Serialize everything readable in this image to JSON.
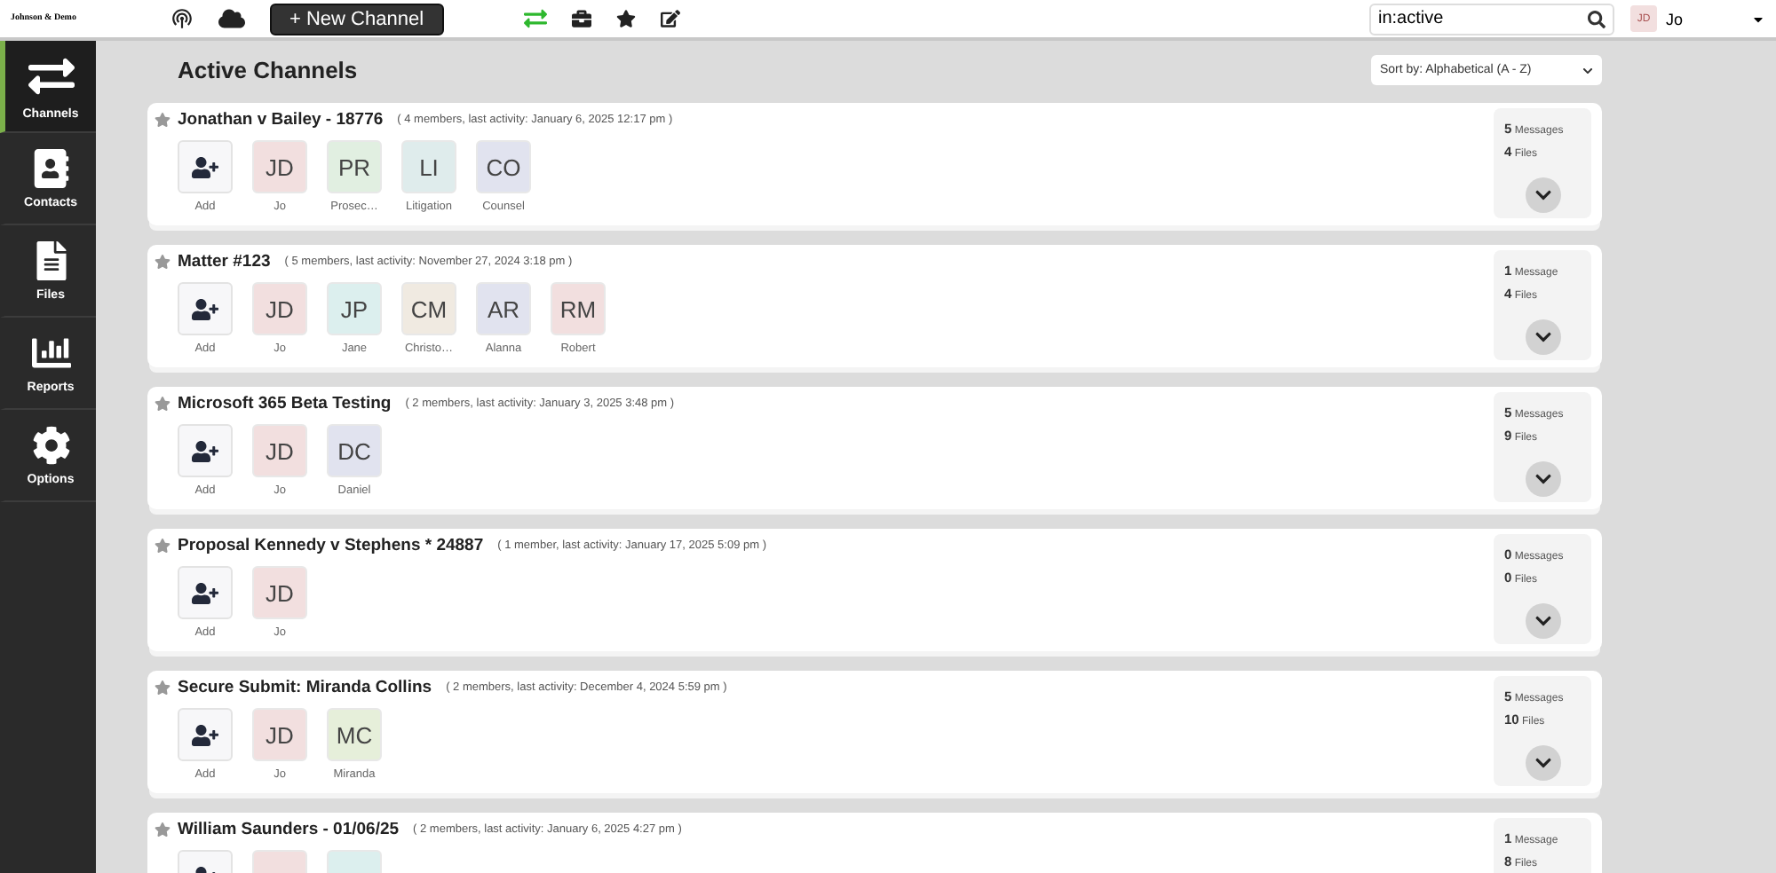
{
  "topbar": {
    "logo": "Johnson & Demo",
    "new_channel": "+ New Channel",
    "search": {
      "value": "in:active"
    },
    "user": {
      "initials": "JD",
      "name": "Jo"
    }
  },
  "sidebar": {
    "items": [
      {
        "label": "Channels",
        "selected": true
      },
      {
        "label": "Contacts",
        "selected": false
      },
      {
        "label": "Files",
        "selected": false
      },
      {
        "label": "Reports",
        "selected": false
      },
      {
        "label": "Options",
        "selected": false
      }
    ]
  },
  "page_title": "Active Channels",
  "sort": {
    "value": "Sort by: Alphabetical (A - Z)"
  },
  "channels": [
    {
      "name": "Jonathan v Bailey - 18776",
      "meta": "( 4 members, last activity: January 6, 2025 12:17 pm )",
      "add_label": "Add",
      "messages": "5",
      "messages_label": "Messages",
      "files": "4",
      "files_label": "Files",
      "members": [
        {
          "initials": "JD",
          "name": "Jo",
          "color": "#f2dfdf"
        },
        {
          "initials": "PR",
          "name": "Prosec…",
          "color": "#e1efe1"
        },
        {
          "initials": "LI",
          "name": "Litigation",
          "color": "#dfecec"
        },
        {
          "initials": "CO",
          "name": "Counsel",
          "color": "#e1e3ef"
        }
      ]
    },
    {
      "name": "Matter #123",
      "meta": "( 5 members, last activity: November 27, 2024 3:18 pm )",
      "add_label": "Add",
      "messages": "1",
      "messages_label": "Message",
      "files": "4",
      "files_label": "Files",
      "members": [
        {
          "initials": "JD",
          "name": "Jo",
          "color": "#f2dfdf"
        },
        {
          "initials": "JP",
          "name": "Jane",
          "color": "#dcefee"
        },
        {
          "initials": "CM",
          "name": "Christo…",
          "color": "#f0eae1"
        },
        {
          "initials": "AR",
          "name": "Alanna",
          "color": "#e1e3ef"
        },
        {
          "initials": "RM",
          "name": "Robert",
          "color": "#f2dfdf"
        }
      ]
    },
    {
      "name": "Microsoft 365 Beta Testing",
      "meta": "( 2 members, last activity: January 3, 2025 3:48 pm )",
      "add_label": "Add",
      "messages": "5",
      "messages_label": "Messages",
      "files": "9",
      "files_label": "Files",
      "members": [
        {
          "initials": "JD",
          "name": "Jo",
          "color": "#f2dfdf"
        },
        {
          "initials": "DC",
          "name": "Daniel",
          "color": "#e1e3ef"
        }
      ]
    },
    {
      "name": "Proposal Kennedy v Stephens * 24887",
      "meta": "( 1 member, last activity: January 17, 2025 5:09 pm )",
      "add_label": "Add",
      "messages": "0",
      "messages_label": "Messages",
      "files": "0",
      "files_label": "Files",
      "members": [
        {
          "initials": "JD",
          "name": "Jo",
          "color": "#f2dfdf"
        }
      ]
    },
    {
      "name": "Secure Submit: Miranda Collins",
      "meta": "( 2 members, last activity: December 4, 2024 5:59 pm )",
      "add_label": "Add",
      "messages": "5",
      "messages_label": "Messages",
      "files": "10",
      "files_label": "Files",
      "members": [
        {
          "initials": "JD",
          "name": "Jo",
          "color": "#f2dfdf"
        },
        {
          "initials": "MC",
          "name": "Miranda",
          "color": "#e6efda"
        }
      ]
    },
    {
      "name": "William Saunders - 01/06/25",
      "meta": "( 2 members, last activity: January 6, 2025 4:27 pm )",
      "messages": "1",
      "messages_label": "Message",
      "files": "8",
      "files_label": "Files",
      "members": [
        {
          "color": "#f2dfdf"
        },
        {
          "color": "#dcefee"
        }
      ]
    }
  ]
}
